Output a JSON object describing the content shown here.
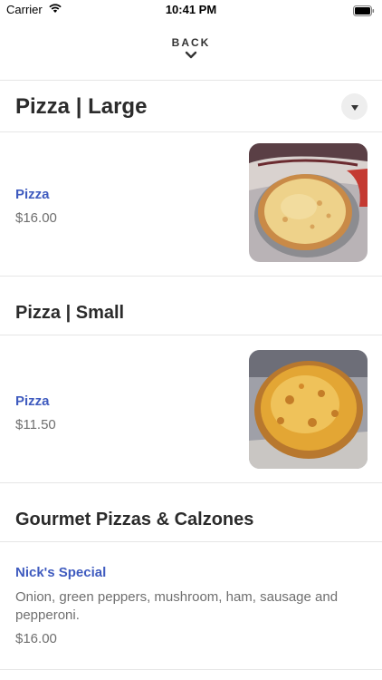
{
  "status_bar": {
    "carrier": "Carrier",
    "time": "10:41 PM"
  },
  "header": {
    "back_label": "BACK"
  },
  "sections": [
    {
      "title": "Pizza | Large",
      "items": [
        {
          "name": "Pizza",
          "price": "$16.00"
        }
      ]
    },
    {
      "title": "Pizza | Small",
      "items": [
        {
          "name": "Pizza",
          "price": "$11.50"
        }
      ]
    },
    {
      "title": "Gourmet Pizzas & Calzones",
      "items": [
        {
          "name": "Nick's Special",
          "description": "Onion, green peppers, mushroom, ham, sausage and pepperoni.",
          "price": "$16.00"
        }
      ]
    }
  ],
  "colors": {
    "link": "#3f5bbf",
    "price": "#6f6f6f",
    "divider": "#e6e6e6"
  },
  "icons": [
    "wifi-icon",
    "battery-icon",
    "chevron-down-icon",
    "dropdown-caret-icon"
  ]
}
